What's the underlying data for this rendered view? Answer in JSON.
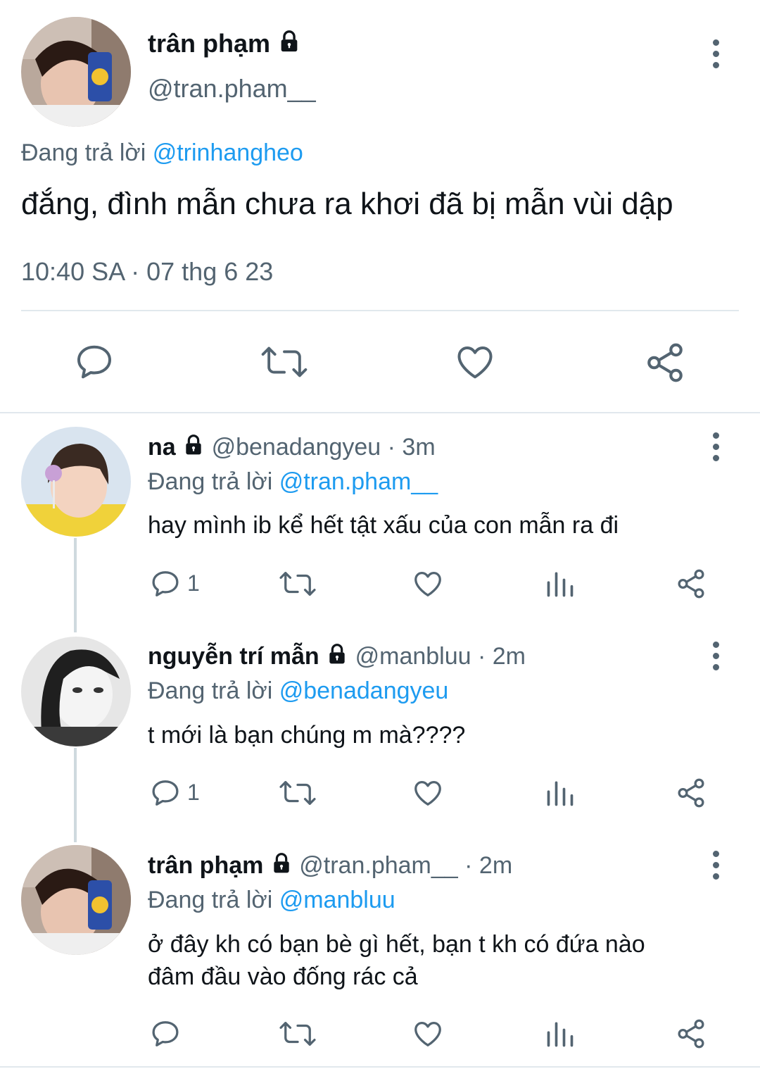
{
  "main_tweet": {
    "display_name": "trân phạm",
    "handle": "@tran.pham__",
    "replying_prefix": "Đang trả lời",
    "replying_to": "@trinhangheo",
    "text": "đắng, đình mẫn chưa ra khơi đã bị mẫn vùi dập",
    "timestamp": "10:40 SA · 07 thg 6 23",
    "actions": [
      "reply-icon",
      "retweet-icon",
      "like-icon",
      "share-icon"
    ]
  },
  "replies": [
    {
      "display_name": "na",
      "handle": "@benadangyeu",
      "time": "· 3m",
      "replying_prefix": "Đang trả lời",
      "replying_to": "@tran.pham__",
      "text": "hay mình ib kể hết tật xấu của con mẫn ra đi",
      "reply_count": "1"
    },
    {
      "display_name": "nguyễn trí mẫn",
      "handle": "@manbluu",
      "time": "· 2m",
      "replying_prefix": "Đang trả lời",
      "replying_to": "@benadangyeu",
      "text": "t mới là bạn chúng m mà????",
      "reply_count": "1"
    },
    {
      "display_name": "trân phạm",
      "handle": "@tran.pham__",
      "time": "· 2m",
      "replying_prefix": "Đang trả lời",
      "replying_to": "@manbluu",
      "text_line1": "ở đây kh có bạn bè gì hết, bạn t kh có đứa nào",
      "text_line2": "đâm đầu vào đống rác cả",
      "reply_count": ""
    }
  ],
  "colors": {
    "text": "#0f1419",
    "secondary": "#536471",
    "link": "#1d9bf0",
    "divider": "#cfd9de"
  }
}
